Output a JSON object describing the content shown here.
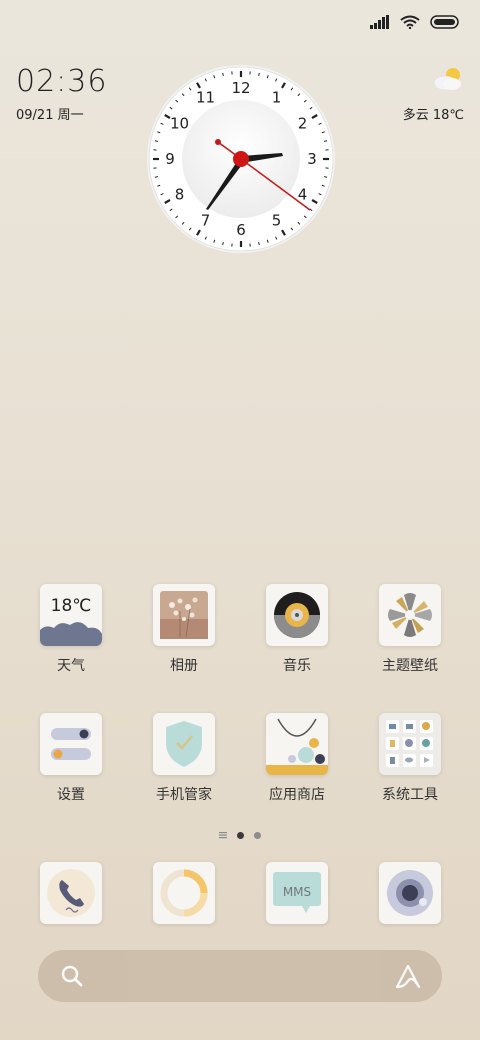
{
  "status_bar": {
    "icons": [
      "signal-icon",
      "wifi-icon",
      "battery-icon"
    ]
  },
  "clock_widget": {
    "time": "02:36",
    "date": "09/21 周一",
    "weather": "多云 18℃",
    "weather_icon": "partly-cloudy-icon",
    "dial_numbers": [
      "12",
      "1",
      "2",
      "3",
      "4",
      "5",
      "6",
      "7",
      "8",
      "9",
      "10",
      "11"
    ]
  },
  "apps_row1": [
    {
      "label": "天气",
      "icon": "weather-app-icon",
      "tile_text": "18℃"
    },
    {
      "label": "相册",
      "icon": "gallery-icon"
    },
    {
      "label": "音乐",
      "icon": "music-icon"
    },
    {
      "label": "主题壁纸",
      "icon": "themes-icon"
    }
  ],
  "apps_row2": [
    {
      "label": "设置",
      "icon": "settings-icon"
    },
    {
      "label": "手机管家",
      "icon": "security-icon"
    },
    {
      "label": "应用商店",
      "icon": "app-store-icon"
    },
    {
      "label": "系统工具",
      "icon": "system-tools-folder-icon"
    }
  ],
  "page_indicator": {
    "pages": 3,
    "current": 2
  },
  "dock": [
    {
      "icon": "phone-icon"
    },
    {
      "icon": "browser-icon"
    },
    {
      "icon": "messages-icon",
      "tile_text": "MMS"
    },
    {
      "icon": "camera-icon"
    }
  ],
  "search_bar": {
    "icons": [
      "search-icon",
      "assistant-icon"
    ]
  }
}
